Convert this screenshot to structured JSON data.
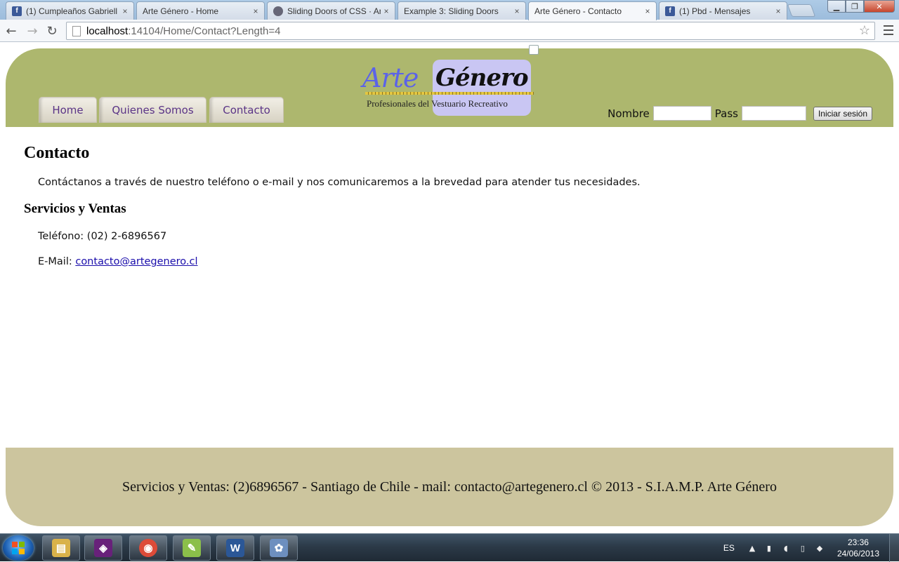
{
  "browser": {
    "tabs": [
      {
        "title": "(1) Cumpleaños Gabriell",
        "icon": "facebook-icon",
        "active": false
      },
      {
        "title": "Arte Género - Home",
        "icon": "page-icon",
        "active": false
      },
      {
        "title": "Sliding Doors of CSS · An",
        "icon": "css-site-icon",
        "active": false
      },
      {
        "title": "Example 3: Sliding Doors",
        "icon": "page-icon",
        "active": false
      },
      {
        "title": "Arte Género - Contacto",
        "icon": "page-icon",
        "active": true
      },
      {
        "title": "(1) Pbd - Mensajes",
        "icon": "facebook-icon",
        "active": false
      }
    ],
    "tab_close_glyph": "×",
    "url_host": "localhost",
    "url_rest": ":14104/Home/Contact?Length=4",
    "window_controls": {
      "minimize": "▁",
      "maximize": "❐",
      "close": "✕"
    },
    "nav": {
      "back": "←",
      "forward": "→",
      "reload": "↻",
      "star": "☆"
    }
  },
  "site": {
    "nav_tabs": [
      "Home",
      "Quienes Somos",
      "Contacto"
    ],
    "logo": {
      "arte": "Arte",
      "genero": "Género",
      "tagline": "Profesionales del Vestuario Recreativo",
      "colors": {
        "arte": "#5b63e8",
        "box": "#c9c6f3"
      }
    },
    "login": {
      "nombre_label": "Nombre",
      "pass_label": "Pass",
      "submit": "Iniciar sesión"
    },
    "header_color": "#adb76e",
    "footer_color": "#ccc59e"
  },
  "content": {
    "title": "Contacto",
    "intro": "Contáctanos a través de nuestro teléfono o e-mail y nos comunicaremos a la brevedad para atender tus necesidades.",
    "section_title": "Servicios y Ventas",
    "phone_text": "Teléfono: (02) 2-6896567",
    "email_label": "E-Mail: ",
    "email_link": "contacto@artegenero.cl"
  },
  "footer": {
    "text": "Servicios y Ventas: (2)6896567 - Santiago de Chile - mail: contacto@artegenero.cl © 2013 - S.I.A.M.P. Arte Género"
  },
  "taskbar": {
    "apps": [
      {
        "name": "windows-explorer-icon",
        "glyph": "▤",
        "color": "#d9b24a"
      },
      {
        "name": "visual-studio-icon",
        "glyph": "◈",
        "color": "#68217a"
      },
      {
        "name": "chrome-icon",
        "glyph": "◉",
        "color": "#dd4b39"
      },
      {
        "name": "notepad-plus-icon",
        "glyph": "✎",
        "color": "#8bbf4a"
      },
      {
        "name": "word-icon",
        "glyph": "W",
        "color": "#2b5797"
      },
      {
        "name": "paint-icon",
        "glyph": "✿",
        "color": "#6d8fbf"
      }
    ],
    "language": "ES",
    "time": "23:36",
    "date": "24/06/2013"
  }
}
